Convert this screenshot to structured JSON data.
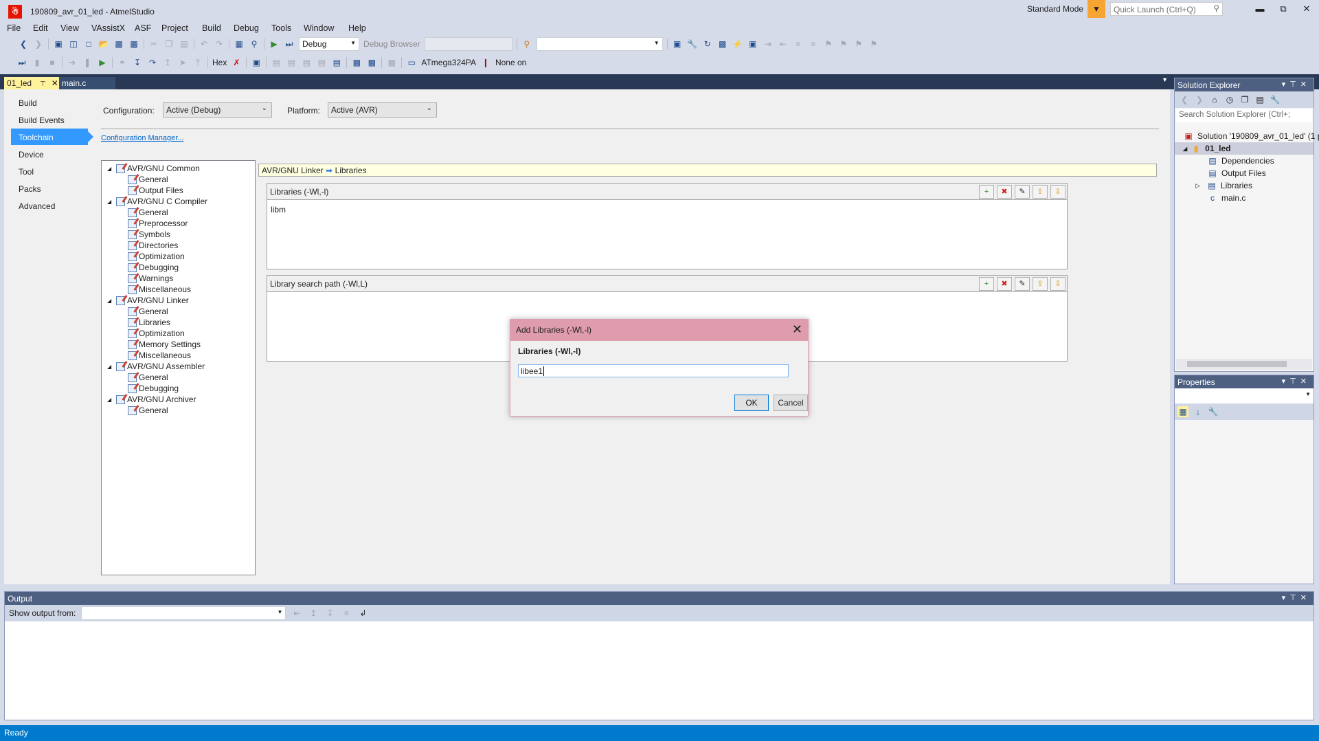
{
  "window": {
    "title": "190809_avr_01_led - AtmelStudio",
    "mode": "Standard Mode",
    "quick_launch_placeholder": "Quick Launch (Ctrl+Q)"
  },
  "menu": [
    "File",
    "Edit",
    "View",
    "VAssistX",
    "ASF",
    "Project",
    "Build",
    "Debug",
    "Tools",
    "Window",
    "Help"
  ],
  "toolbar": {
    "config": "Debug",
    "debug_browser": "Debug Browser",
    "hex": "Hex",
    "device": "ATmega324PA",
    "tool": "None on"
  },
  "tabs": [
    {
      "label": "01_led"
    },
    {
      "label": "main.c"
    }
  ],
  "nav": [
    "Build",
    "Build Events",
    "Toolchain",
    "Device",
    "Tool",
    "Packs",
    "Advanced"
  ],
  "config": {
    "config_label": "Configuration:",
    "config_value": "Active (Debug)",
    "platform_label": "Platform:",
    "platform_value": "Active (AVR)",
    "manager_link": "Configuration Manager..."
  },
  "tree": [
    {
      "label": "AVR/GNU Common",
      "level": 0
    },
    {
      "label": "General",
      "level": 1
    },
    {
      "label": "Output Files",
      "level": 1
    },
    {
      "label": "AVR/GNU C Compiler",
      "level": 0
    },
    {
      "label": "General",
      "level": 1
    },
    {
      "label": "Preprocessor",
      "level": 1
    },
    {
      "label": "Symbols",
      "level": 1
    },
    {
      "label": "Directories",
      "level": 1
    },
    {
      "label": "Optimization",
      "level": 1
    },
    {
      "label": "Debugging",
      "level": 1
    },
    {
      "label": "Warnings",
      "level": 1
    },
    {
      "label": "Miscellaneous",
      "level": 1
    },
    {
      "label": "AVR/GNU Linker",
      "level": 0
    },
    {
      "label": "General",
      "level": 1
    },
    {
      "label": "Libraries",
      "level": 1
    },
    {
      "label": "Optimization",
      "level": 1
    },
    {
      "label": "Memory Settings",
      "level": 1
    },
    {
      "label": "Miscellaneous",
      "level": 1
    },
    {
      "label": "AVR/GNU Assembler",
      "level": 0
    },
    {
      "label": "General",
      "level": 1
    },
    {
      "label": "Debugging",
      "level": 1
    },
    {
      "label": "AVR/GNU Archiver",
      "level": 0
    },
    {
      "label": "General",
      "level": 1
    }
  ],
  "breadcrumb": {
    "parent": "AVR/GNU Linker",
    "child": "Libraries"
  },
  "libraries_panel": {
    "title": "Libraries (-Wl,-l)",
    "items": [
      "libm"
    ]
  },
  "search_path_panel": {
    "title": "Library search path (-Wl,L)"
  },
  "dialog": {
    "title": "Add Libraries (-Wl,-l)",
    "label": "Libraries (-Wl,-l)",
    "value": "libee1",
    "ok": "OK",
    "cancel": "Cancel"
  },
  "solution_explorer": {
    "title": "Solution Explorer",
    "search_placeholder": "Search Solution Explorer (Ctrl+;",
    "solution": "Solution '190809_avr_01_led' (1 p",
    "project": "01_led",
    "items": [
      "Dependencies",
      "Output Files",
      "Libraries",
      "main.c"
    ]
  },
  "properties": {
    "title": "Properties"
  },
  "output": {
    "title": "Output",
    "show_from": "Show output from:"
  },
  "status": "Ready"
}
